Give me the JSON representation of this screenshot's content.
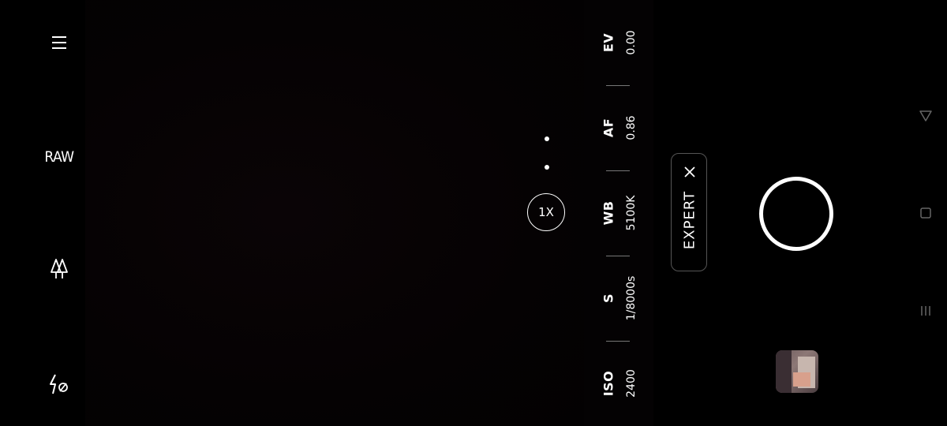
{
  "left_toolbar": {
    "menu_icon": "hamburger-menu-icon",
    "raw_label": "RAW",
    "scene_icon": "tree-icon",
    "flash_icon": "flash-off-icon"
  },
  "zoom": {
    "label": "1X"
  },
  "parameters": [
    {
      "name": "EV",
      "value": "0.00"
    },
    {
      "name": "AF",
      "value": "0.86"
    },
    {
      "name": "WB",
      "value": "5100K"
    },
    {
      "name": "S",
      "value": "1/8000s"
    },
    {
      "name": "ISO",
      "value": "2400"
    }
  ],
  "expert_mode": {
    "label": "EXPERT",
    "close_icon": "close-icon"
  },
  "shutter": {
    "icon": "shutter-button"
  },
  "gallery": {
    "icon": "gallery-thumbnail"
  },
  "navigation": {
    "back": "back-triangle-icon",
    "home": "home-square-icon",
    "recents": "recents-lines-icon"
  },
  "colors": {
    "background": "#000000",
    "foreground": "#ffffff",
    "separator": "#777777"
  }
}
